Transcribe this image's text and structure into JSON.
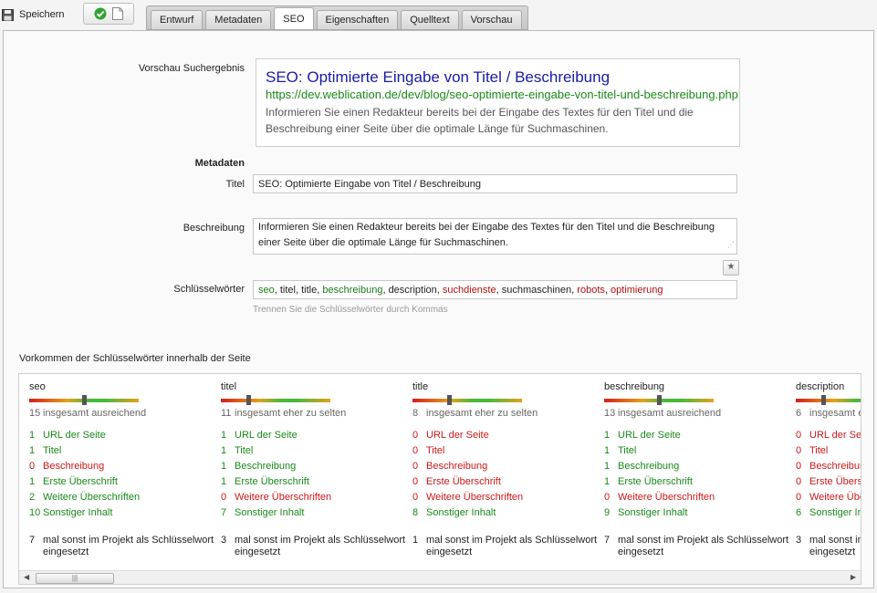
{
  "toolbar": {
    "save_label": "Speichern"
  },
  "tabs": [
    {
      "label": "Entwurf"
    },
    {
      "label": "Metadaten"
    },
    {
      "label": "SEO"
    },
    {
      "label": "Eigenschaften"
    },
    {
      "label": "Quelltext"
    },
    {
      "label": "Vorschau"
    }
  ],
  "active_tab": "SEO",
  "preview": {
    "label": "Vorschau Suchergebnis",
    "title": "SEO: Optimierte Eingabe von Titel / Beschreibung",
    "url": "https://dev.weblication.de/dev/blog/seo-optimierte-eingabe-von-titel-und-beschreibung.php",
    "description": "Informieren Sie einen Redakteur bereits bei der Eingabe des Textes für den Titel und die Beschreibung einer Seite über die optimale Länge für Suchmaschinen."
  },
  "metadaten": {
    "heading": "Metadaten",
    "titel_label": "Titel",
    "titel_value": "SEO: Optimierte Eingabe von Titel / Beschreibung",
    "beschreibung_label": "Beschreibung",
    "beschreibung_value": "Informieren Sie einen Redakteur bereits bei der Eingabe des Textes für den Titel und die Beschreibung einer Seite über die optimale Länge für Suchmaschinen.",
    "keywords_label": "Schlüsselwörter",
    "keywords": [
      {
        "text": "seo",
        "status": "green"
      },
      {
        "text": "titel",
        "status": "dark"
      },
      {
        "text": "title",
        "status": "dark"
      },
      {
        "text": "beschreibung",
        "status": "green"
      },
      {
        "text": "description",
        "status": "dark"
      },
      {
        "text": "suchdienste",
        "status": "red"
      },
      {
        "text": "suchmaschinen",
        "status": "dark"
      },
      {
        "text": "robots",
        "status": "red"
      },
      {
        "text": "optimierung",
        "status": "red"
      }
    ],
    "keywords_hint": "Trennen Sie die Schlüsselwörter durch Kommas"
  },
  "occurrence": {
    "heading": "Vorkommen der Schlüsselwörter innerhalb der Seite",
    "row_labels": [
      "URL der Seite",
      "Titel",
      "Beschreibung",
      "Erste Überschrift",
      "Weitere Überschriften",
      "Sonstiger Inhalt"
    ],
    "other_text": "mal sonst im Projekt als Schlüsselwort eingesetzt",
    "keywords": [
      {
        "name": "seo",
        "total": 15,
        "total_text": "insgesamt ausreichend",
        "meter": 0.5,
        "counts": [
          1,
          1,
          0,
          1,
          2,
          10
        ],
        "other": 7
      },
      {
        "name": "titel",
        "total": 11,
        "total_text": "insgesamt eher zu selten",
        "meter": 0.25,
        "counts": [
          1,
          1,
          1,
          1,
          0,
          7
        ],
        "other": 3
      },
      {
        "name": "title",
        "total": 8,
        "total_text": "insgesamt eher zu selten",
        "meter": 0.33,
        "counts": [
          0,
          0,
          0,
          0,
          0,
          8
        ],
        "other": 1
      },
      {
        "name": "beschreibung",
        "total": 13,
        "total_text": "insgesamt ausreichend",
        "meter": 0.5,
        "counts": [
          1,
          1,
          1,
          1,
          0,
          9
        ],
        "other": 7
      },
      {
        "name": "description",
        "total": 6,
        "total_text": "insgesamt eher zu selten",
        "meter": 0.25,
        "counts": [
          0,
          0,
          0,
          0,
          0,
          6
        ],
        "other": 3
      }
    ]
  }
}
